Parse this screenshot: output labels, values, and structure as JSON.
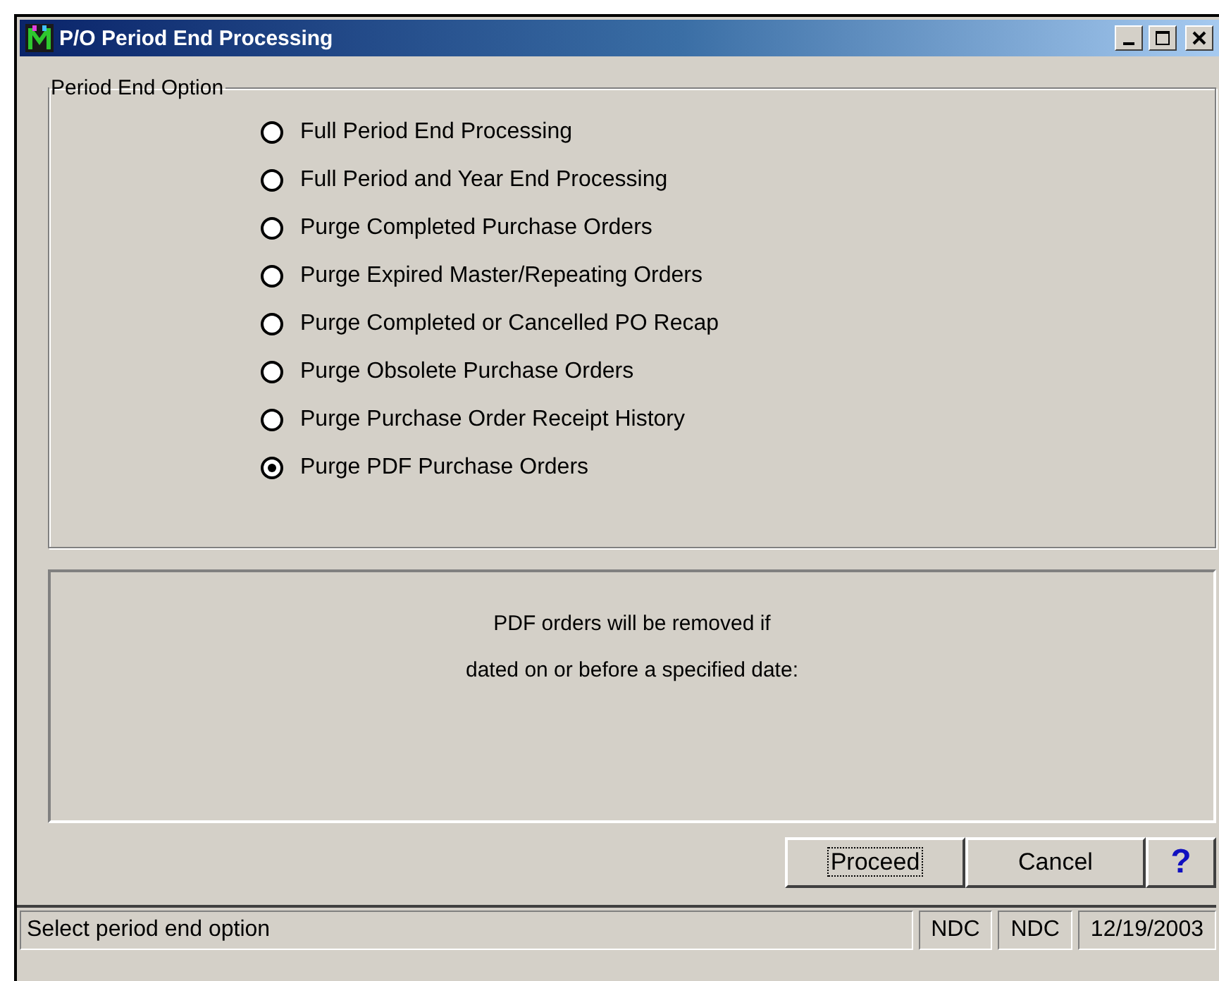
{
  "window": {
    "title": "P/O Period End Processing"
  },
  "group": {
    "label": "Period End Option",
    "options": [
      {
        "label": "Full Period End Processing",
        "selected": false
      },
      {
        "label": "Full Period and Year End Processing",
        "selected": false
      },
      {
        "label": "Purge Completed Purchase Orders",
        "selected": false
      },
      {
        "label": "Purge Expired Master/Repeating Orders",
        "selected": false
      },
      {
        "label": "Purge Completed or Cancelled PO Recap",
        "selected": false
      },
      {
        "label": "Purge Obsolete Purchase Orders",
        "selected": false
      },
      {
        "label": "Purge Purchase Order Receipt History",
        "selected": false
      },
      {
        "label": "Purge PDF Purchase Orders",
        "selected": true
      }
    ]
  },
  "message_lines": [
    "PDF orders will be removed if",
    "dated on or before a specified date:"
  ],
  "buttons": [
    {
      "label": "Proceed",
      "kind": "text",
      "focused": true
    },
    {
      "label": "Cancel",
      "kind": "text",
      "focused": false
    },
    {
      "label": "?",
      "kind": "help",
      "focused": false
    }
  ],
  "status_bar": {
    "message": "Select period end option",
    "panels": [
      "NDC",
      "NDC",
      "12/19/2003"
    ]
  }
}
